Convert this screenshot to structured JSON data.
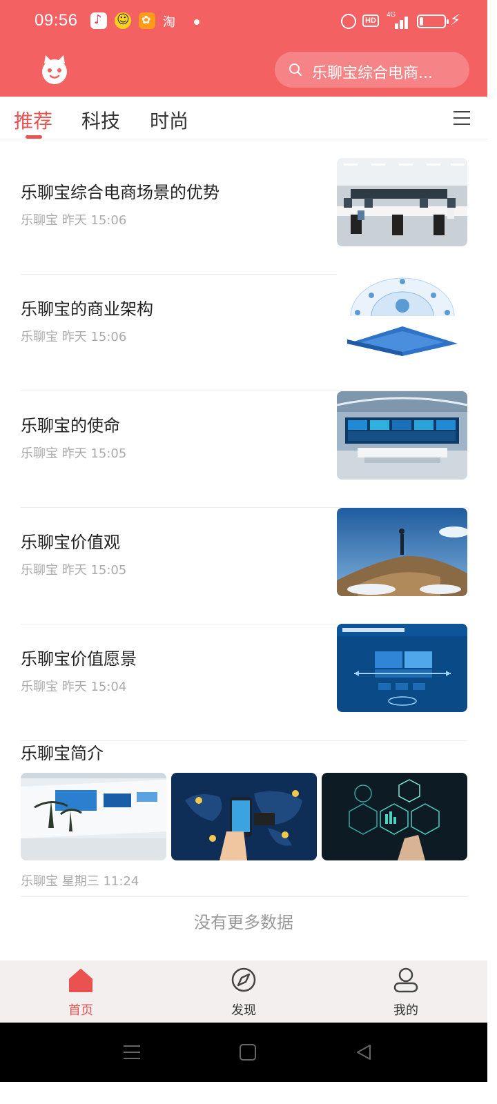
{
  "status_bar": {
    "time": "09:56",
    "app_icon_text": "淘",
    "hd_label": "HD",
    "network_label": "4G"
  },
  "header": {
    "search_placeholder": "乐聊宝综合电商..."
  },
  "tabs": [
    {
      "label": "推荐",
      "active": true
    },
    {
      "label": "科技",
      "active": false
    },
    {
      "label": "时尚",
      "active": false
    }
  ],
  "feed": [
    {
      "title": "乐聊宝综合电商场景的优势",
      "source": "乐聊宝",
      "time": "昨天 15:06",
      "image": "office-workspace"
    },
    {
      "title": "乐聊宝的商业架构",
      "source": "乐聊宝",
      "time": "昨天 15:06",
      "image": "business-architecture-diagram"
    },
    {
      "title": "乐聊宝的使命",
      "source": "乐聊宝",
      "time": "昨天 15:05",
      "image": "control-room"
    },
    {
      "title": "乐聊宝价值观",
      "source": "乐聊宝",
      "time": "昨天 15:05",
      "image": "mountain-summit"
    },
    {
      "title": "乐聊宝价值愿景",
      "source": "乐聊宝",
      "time": "昨天 15:04",
      "image": "data-vision-diagram"
    }
  ],
  "multi_item": {
    "title": "乐聊宝简介",
    "source": "乐聊宝",
    "time": "星期三 11:24",
    "images": [
      "exhibition-wall",
      "online-shopping-map",
      "big-data-hexagons"
    ]
  },
  "footer_text": "没有更多数据",
  "bottom_nav": [
    {
      "label": "首页",
      "icon": "home-icon",
      "active": true
    },
    {
      "label": "发现",
      "icon": "discover-icon",
      "active": false
    },
    {
      "label": "我的",
      "icon": "profile-icon",
      "active": false
    }
  ],
  "colors": {
    "brand": "#F46163",
    "accent": "#E9524F",
    "meta_text": "#aaaaaa"
  }
}
